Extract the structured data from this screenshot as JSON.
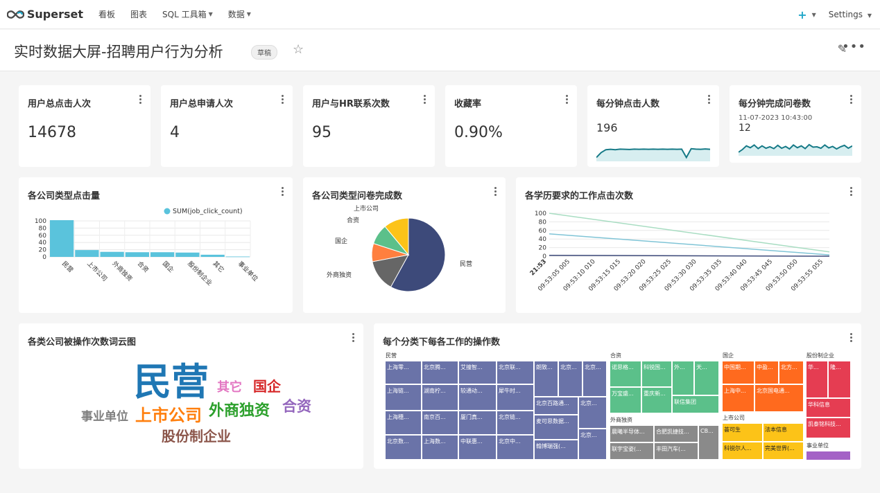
{
  "nav": {
    "brand": "Superset",
    "items": [
      {
        "label": "看板",
        "caret": false
      },
      {
        "label": "图表",
        "caret": false
      },
      {
        "label": "SQL 工具箱",
        "caret": true
      },
      {
        "label": "数据",
        "caret": true
      }
    ],
    "plus": "+",
    "settings": "Settings"
  },
  "header": {
    "title": "实时数据大屏-招聘用户行为分析",
    "badge": "草稿"
  },
  "kpis": [
    {
      "title": "用户总点击人次",
      "value": "14678"
    },
    {
      "title": "用户总申请人次",
      "value": "4"
    },
    {
      "title": "用户与HR联系次数",
      "value": "95"
    },
    {
      "title": "收藏率",
      "value": "0.90%"
    }
  ],
  "spark1": {
    "title": "每分钟点击人数",
    "value": "196",
    "points": [
      0.2,
      0.45,
      0.6,
      0.62,
      0.6,
      0.63,
      0.62,
      0.61,
      0.63,
      0.62,
      0.63,
      0.62,
      0.63,
      0.62,
      0.63,
      0.62,
      0.63,
      0.62,
      0.63,
      0.2,
      0.65,
      0.63,
      0.62,
      0.64,
      0.62
    ]
  },
  "spark2": {
    "title": "每分钟完成问卷数",
    "timestamp": "11-07-2023 10:43:00",
    "value": "12",
    "points": [
      0.2,
      0.35,
      0.55,
      0.45,
      0.6,
      0.4,
      0.55,
      0.42,
      0.5,
      0.4,
      0.58,
      0.42,
      0.52,
      0.38,
      0.6,
      0.45,
      0.55,
      0.4,
      0.62,
      0.48,
      0.5,
      0.42,
      0.6,
      0.44,
      0.52,
      0.38,
      0.5,
      0.58,
      0.42,
      0.55
    ]
  },
  "bar": {
    "title": "各公司类型点击量",
    "chart_data": {
      "type": "bar",
      "legend": "SUM(job_click_count)",
      "legend_position": "top",
      "categories": [
        "民营",
        "上市公司",
        "外商独资",
        "合资",
        "国企",
        "股份制企业",
        "其它",
        "事业单位"
      ],
      "values": [
        102,
        19,
        14,
        13,
        13,
        12,
        6,
        1
      ],
      "yticks": [
        "100",
        "80",
        "60",
        "40",
        "20",
        "0"
      ],
      "ylim": [
        0,
        100
      ],
      "color": "#5ac3dc"
    }
  },
  "pie": {
    "title": "各公司类型问卷完成数",
    "chart_data": {
      "type": "pie",
      "labels": [
        "民营",
        "外商独资",
        "国企",
        "合资",
        "上市公司"
      ],
      "values": [
        58,
        14,
        8,
        9,
        11
      ],
      "colors": [
        "#3d4a7a",
        "#666666",
        "#ff7f3f",
        "#5bc08a",
        "#fcc318"
      ]
    }
  },
  "line": {
    "title": "各学历要求的工作点击次数",
    "chart_data": {
      "type": "line",
      "yticks": [
        "100",
        "80",
        "60",
        "40",
        "20",
        "0"
      ],
      "ylim": [
        0,
        100
      ],
      "first_label": "21:53",
      "xlabels": [
        "09:53:05 005",
        "09:53:10 010",
        "09:53:15 015",
        "09:53:20 020",
        "09:53:25 025",
        "09:53:30 030",
        "09:53:35 035",
        "09:53:40 040",
        "09:53:45 045",
        "09:53:50 050",
        "09:53:55 055"
      ],
      "series": [
        {
          "values": [
            100,
            10
          ],
          "color": "#a8ddc2"
        },
        {
          "values": [
            52,
            3
          ],
          "color": "#7fc4d6"
        },
        {
          "values": [
            2,
            0
          ],
          "color": "#3d4a7a"
        }
      ]
    }
  },
  "cloud": {
    "title": "各类公司被操作次数词云图",
    "words": [
      {
        "text": "民营",
        "color": "#1f77b4"
      },
      {
        "text": "其它",
        "color": "#e377c2"
      },
      {
        "text": "国企",
        "color": "#d62728"
      },
      {
        "text": "事业单位",
        "color": "#7f7f7f"
      },
      {
        "text": "上市公司",
        "color": "#ff7f0e"
      },
      {
        "text": "外商独资",
        "color": "#2ca02c"
      },
      {
        "text": "合资",
        "color": "#9467bd"
      },
      {
        "text": "股份制企业",
        "color": "#8c564b"
      }
    ]
  },
  "treemap": {
    "title": "每个分类下每各工作的操作数",
    "groups": [
      {
        "label": "民营",
        "color": "#6a73a8"
      },
      {
        "label": "合资",
        "color": "#5bc08a"
      },
      {
        "label": "国企",
        "color": "#ff6a1e"
      },
      {
        "label": "股份制企业",
        "color": "#e53d52"
      },
      {
        "label": "外商独资",
        "color": "#8a8a8a"
      },
      {
        "label": "上市公司",
        "color": "#fcc318"
      },
      {
        "label": "事业单位",
        "color": "#a462c6"
      }
    ],
    "cells": [
      "上海零...",
      "北京腾...",
      "艾撞智...",
      "北京联...",
      "朗致...",
      "北京...",
      "北京...",
      "上海链...",
      "湖南柠...",
      "较通动...",
      "犀牛时...",
      "北京百路通...",
      "北京...",
      "上海穗...",
      "南京百...",
      "厦门真...",
      "北京链...",
      "麦可思数据...",
      "北京数...",
      "上海数...",
      "中联惠...",
      "北京中...",
      "翰博瑞强(...",
      "北京...",
      "诺思格...",
      "科锐国...",
      "外...",
      "天...",
      "万宝盛...",
      "重庆新...",
      "联信集团",
      "晨曦半导体...",
      "合肥凯捷技...",
      "CB...",
      "联宇宝姿(...",
      "丰田汽车(...",
      "中国期...",
      "中盈...",
      "北方...",
      "上海中...",
      "北京国电通...",
      "荟可生",
      "法本信息",
      "科锐尔人...",
      "完美世界(...",
      "华...",
      "隆...",
      "华科信息",
      "凯泰铭科技..."
    ]
  }
}
